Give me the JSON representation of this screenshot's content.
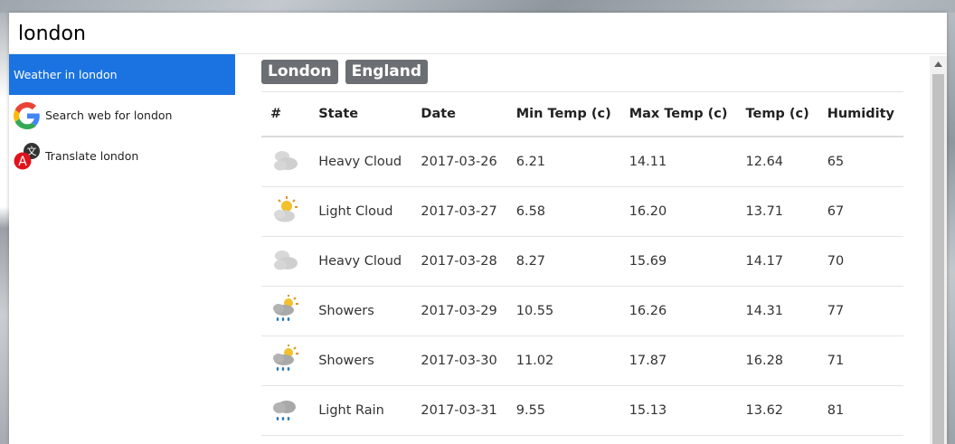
{
  "search": {
    "value": "london"
  },
  "sidebar": {
    "items": [
      {
        "label": "Weather in london",
        "active": true
      },
      {
        "label": "Search web for london",
        "icon": "google-g-icon"
      },
      {
        "label": "Translate london",
        "icon": "translate-icon"
      }
    ]
  },
  "tags": [
    "London",
    "England"
  ],
  "table": {
    "headers": [
      "#",
      "State",
      "Date",
      "Min Temp (c)",
      "Max Temp (c)",
      "Temp (c)",
      "Humidity"
    ],
    "rows": [
      {
        "icon": "heavy-cloud-icon",
        "state": "Heavy Cloud",
        "date": "2017-03-26",
        "min": "6.21",
        "max": "14.11",
        "temp": "12.64",
        "humidity": "65"
      },
      {
        "icon": "light-cloud-icon",
        "state": "Light Cloud",
        "date": "2017-03-27",
        "min": "6.58",
        "max": "16.20",
        "temp": "13.71",
        "humidity": "67"
      },
      {
        "icon": "heavy-cloud-icon",
        "state": "Heavy Cloud",
        "date": "2017-03-28",
        "min": "8.27",
        "max": "15.69",
        "temp": "14.17",
        "humidity": "70"
      },
      {
        "icon": "showers-icon",
        "state": "Showers",
        "date": "2017-03-29",
        "min": "10.55",
        "max": "16.26",
        "temp": "14.31",
        "humidity": "77"
      },
      {
        "icon": "showers-icon",
        "state": "Showers",
        "date": "2017-03-30",
        "min": "11.02",
        "max": "17.87",
        "temp": "16.28",
        "humidity": "71"
      },
      {
        "icon": "light-rain-icon",
        "state": "Light Rain",
        "date": "2017-03-31",
        "min": "9.55",
        "max": "15.13",
        "temp": "13.62",
        "humidity": "81"
      }
    ]
  },
  "colors": {
    "accent": "#1a73e0",
    "tag_bg": "#6b6f73"
  }
}
